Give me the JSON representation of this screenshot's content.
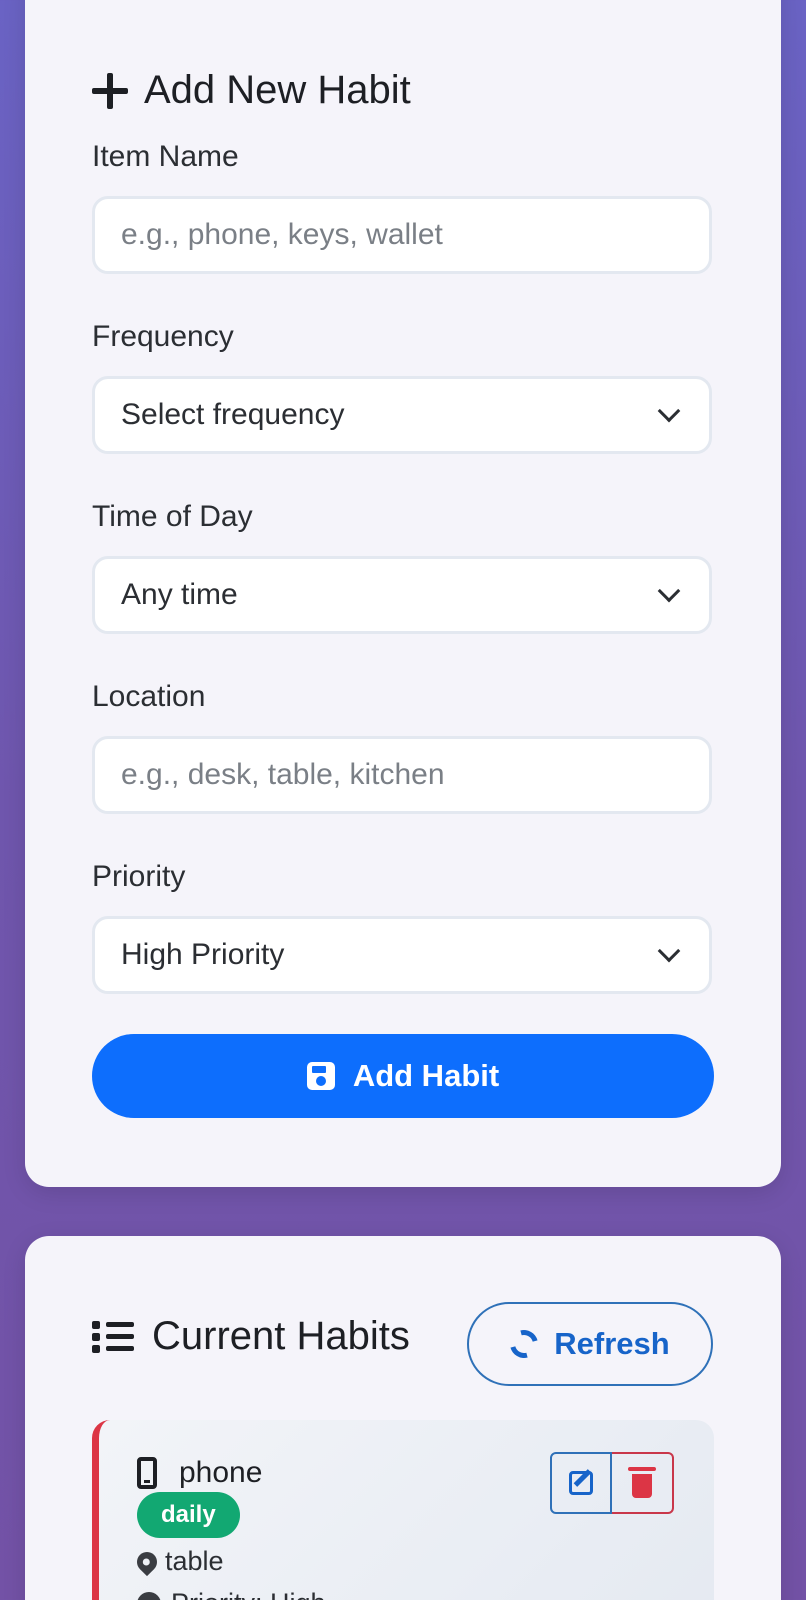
{
  "form": {
    "title": "Add New Habit",
    "submit_label": "Add Habit",
    "fields": {
      "item_name": {
        "label": "Item Name",
        "placeholder": "e.g., phone, keys, wallet",
        "value": ""
      },
      "frequency": {
        "label": "Frequency",
        "selected": "Select frequency"
      },
      "time_of_day": {
        "label": "Time of Day",
        "selected": "Any time"
      },
      "location": {
        "label": "Location",
        "placeholder": "e.g., desk, table, kitchen",
        "value": ""
      },
      "priority": {
        "label": "Priority",
        "selected": "High Priority"
      }
    }
  },
  "habits_list": {
    "title": "Current Habits",
    "refresh_label": "Refresh",
    "items": [
      {
        "name": "phone",
        "icon": "mobile-phone-icon",
        "frequency": "daily",
        "location": "table",
        "priority_text": "Priority: High"
      }
    ]
  },
  "colors": {
    "background_gradient": [
      "#6a63c4",
      "#7352a6"
    ],
    "card": "#f5f4fa",
    "primary": "#0d6efd",
    "outline_blue": "#1764c9",
    "danger": "#dc3545",
    "success_badge": "#12a872"
  }
}
